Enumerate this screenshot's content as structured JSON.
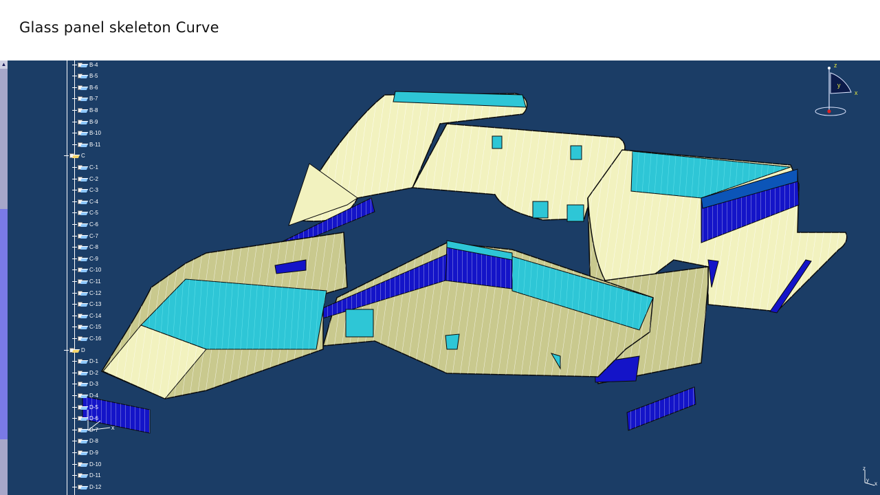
{
  "slide": {
    "title": "Glass panel skeleton Curve"
  },
  "tree": {
    "nodes": [
      {
        "label": "B-4",
        "group": false
      },
      {
        "label": "B-5",
        "group": false
      },
      {
        "label": "B-6",
        "group": false
      },
      {
        "label": "B-7",
        "group": false
      },
      {
        "label": "B-8",
        "group": false
      },
      {
        "label": "B-9",
        "group": false
      },
      {
        "label": "B-10",
        "group": false
      },
      {
        "label": "B-11",
        "group": false
      },
      {
        "label": "C",
        "group": true
      },
      {
        "label": "C-1",
        "group": false
      },
      {
        "label": "C-2",
        "group": false
      },
      {
        "label": "C-3",
        "group": false
      },
      {
        "label": "C-4",
        "group": false
      },
      {
        "label": "C-5",
        "group": false
      },
      {
        "label": "C-6",
        "group": false
      },
      {
        "label": "C-7",
        "group": false
      },
      {
        "label": "C-8",
        "group": false
      },
      {
        "label": "C-9",
        "group": false
      },
      {
        "label": "C-10",
        "group": false
      },
      {
        "label": "C-11",
        "group": false
      },
      {
        "label": "C-12",
        "group": false
      },
      {
        "label": "C-13",
        "group": false
      },
      {
        "label": "C-14",
        "group": false
      },
      {
        "label": "C-15",
        "group": false
      },
      {
        "label": "C-16",
        "group": false
      },
      {
        "label": "D",
        "group": true
      },
      {
        "label": "D-1",
        "group": false
      },
      {
        "label": "D-2",
        "group": false
      },
      {
        "label": "D-3",
        "group": false
      },
      {
        "label": "D-4",
        "group": false
      },
      {
        "label": "D-5",
        "group": false
      },
      {
        "label": "D-6",
        "group": false
      },
      {
        "label": "D-7",
        "group": false
      },
      {
        "label": "D-8",
        "group": false
      },
      {
        "label": "D-9",
        "group": false
      },
      {
        "label": "D-10",
        "group": false
      },
      {
        "label": "D-11",
        "group": false
      },
      {
        "label": "D-12",
        "group": false
      }
    ]
  },
  "compass": {
    "x_label": "x",
    "y_label": "y",
    "z_label": "z"
  },
  "mini_axis": {
    "x_label": "x",
    "y_label": "y",
    "z_label": "z"
  },
  "colors": {
    "background": "#1b3d66",
    "panel_cream": "#f2f2bf",
    "panel_olive": "#c9c98e",
    "glass_cyan": "#2ec6d6",
    "glass_blue": "#1414c8",
    "edge": "#0a0a0a"
  }
}
